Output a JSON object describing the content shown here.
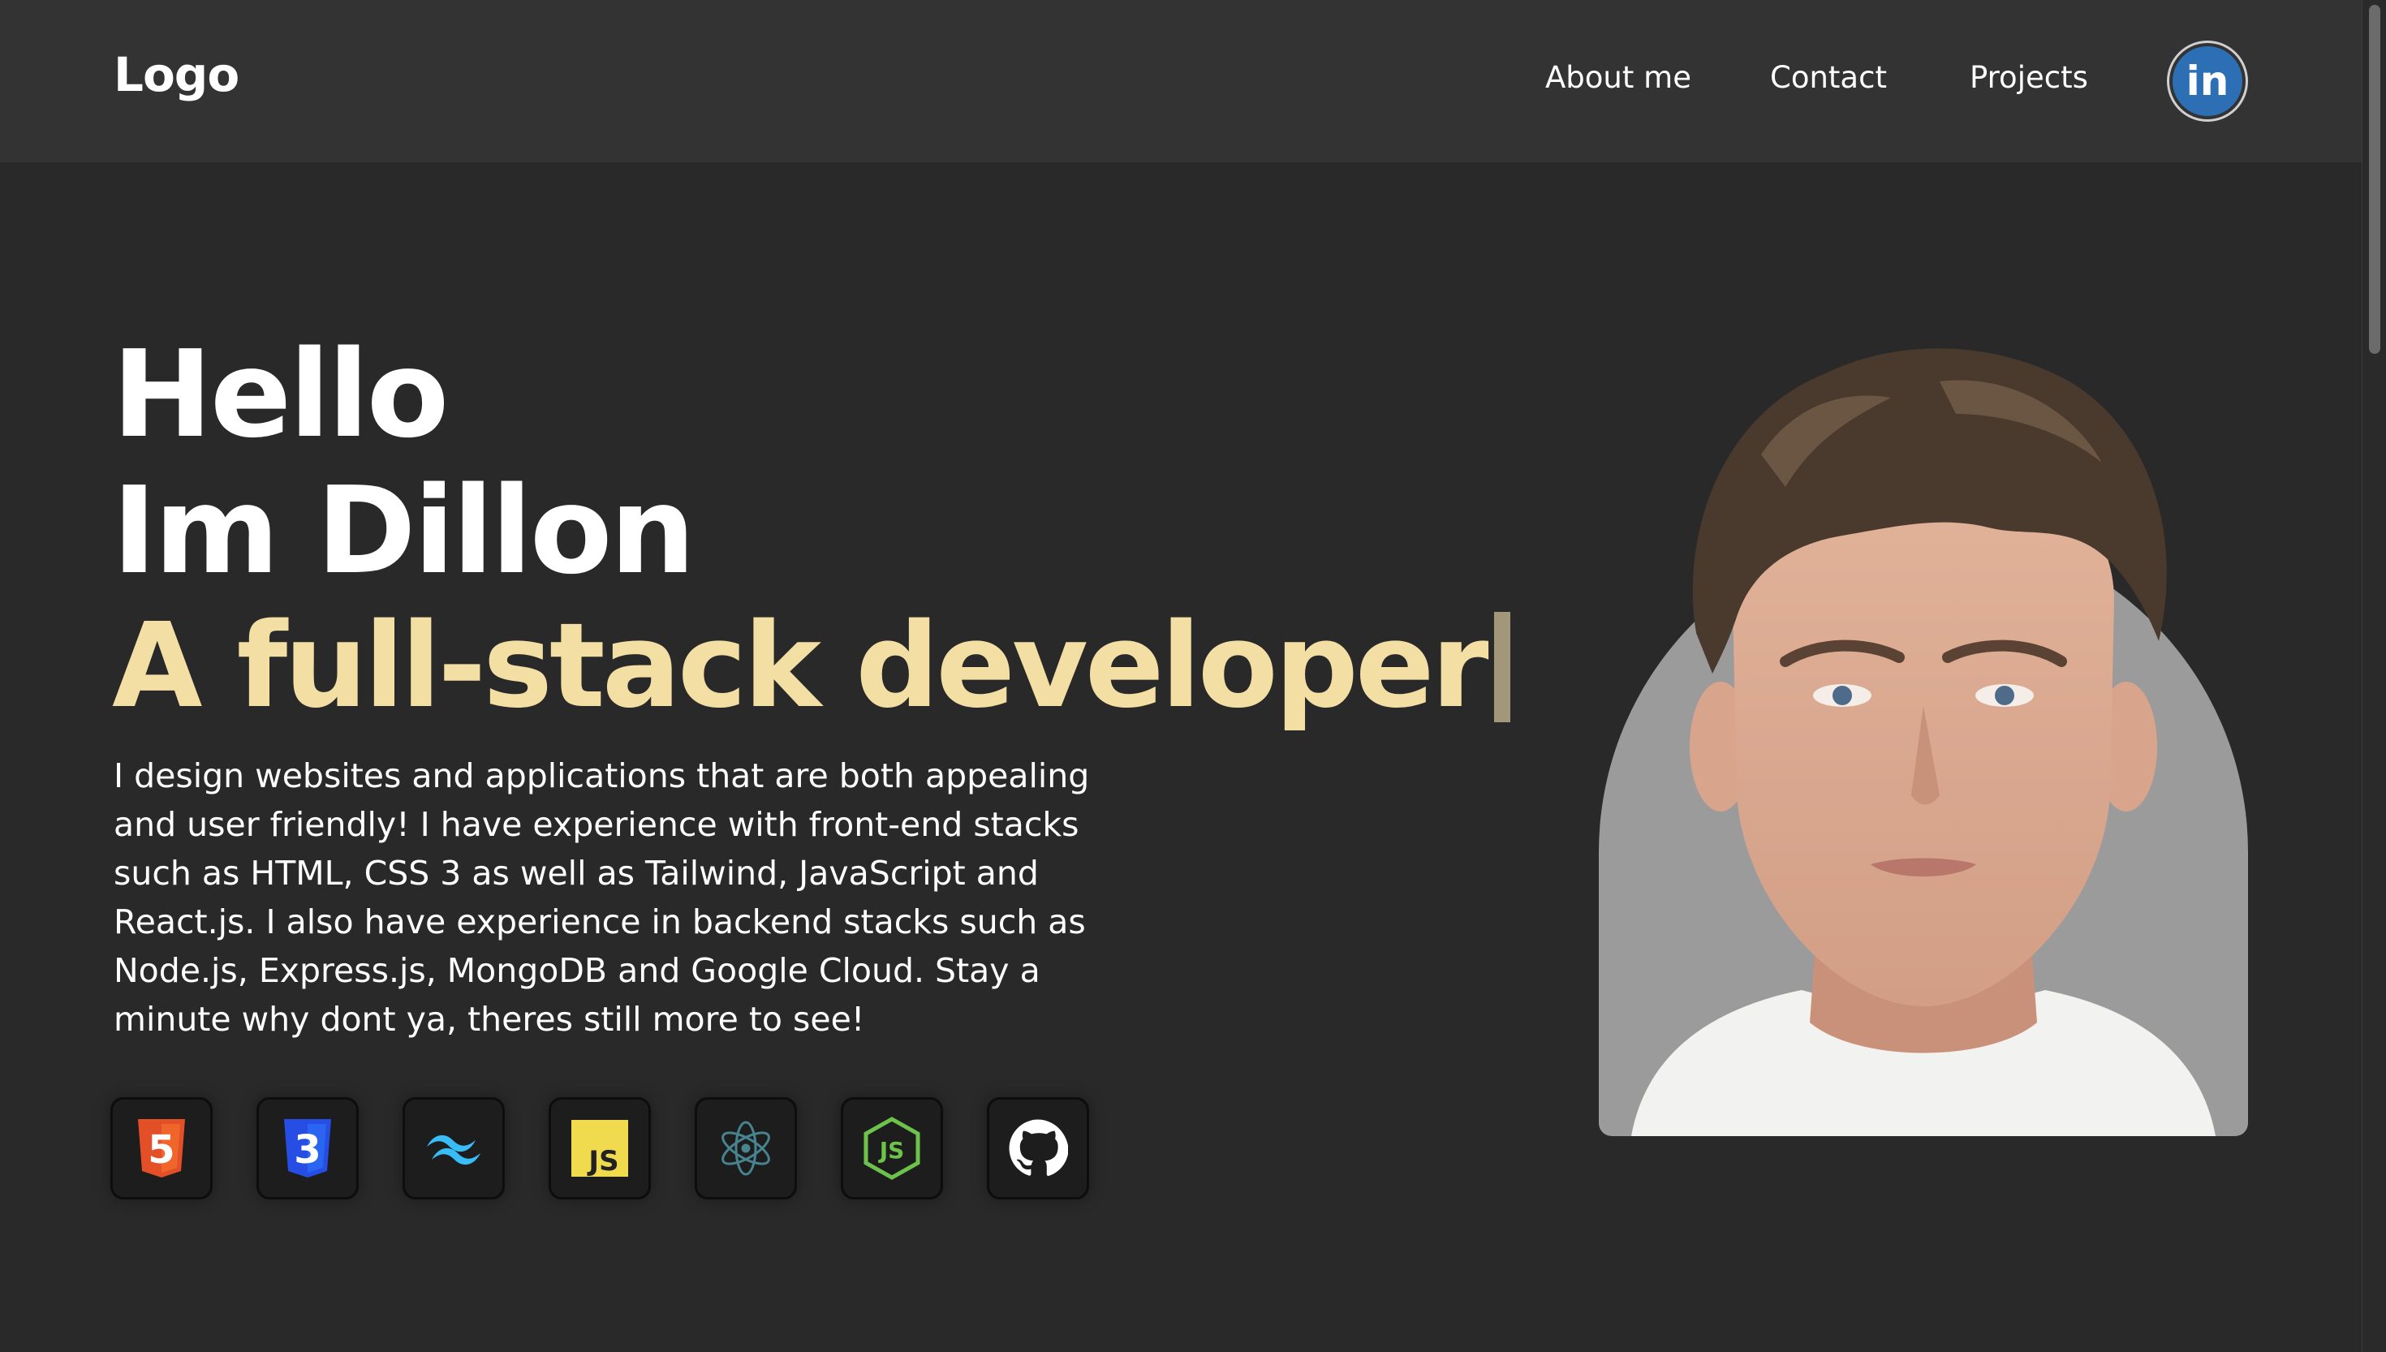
{
  "header": {
    "logo": "Logo",
    "nav": {
      "about": "About me",
      "contact": "Contact",
      "projects": "Projects"
    },
    "social_icon": "linkedin-icon",
    "social_label": "in"
  },
  "hero": {
    "line1": "Hello",
    "line2": "Im Dillon",
    "role": "A full-stack developer",
    "bio": "I design websites and applications that are both appealing and user friendly! I have experience with front-end stacks such as HTML, CSS 3 as well as Tailwind, JavaScript and React.js. I also have experience in backend stacks such as Node.js, Express.js, MongoDB and Google Cloud. Stay a minute why dont ya, theres still more to see!"
  },
  "tech_icons": [
    "html5-icon",
    "css3-icon",
    "tailwind-icon",
    "javascript-icon",
    "electron-icon",
    "nodejs-icon",
    "github-icon"
  ],
  "icon_text": {
    "html": "5",
    "css": "3",
    "js": "JS",
    "node": "JS"
  },
  "colors": {
    "background": "#292929",
    "header": "#333333",
    "accent": "#f3dfa4",
    "linkedin": "#2d6fb5"
  }
}
